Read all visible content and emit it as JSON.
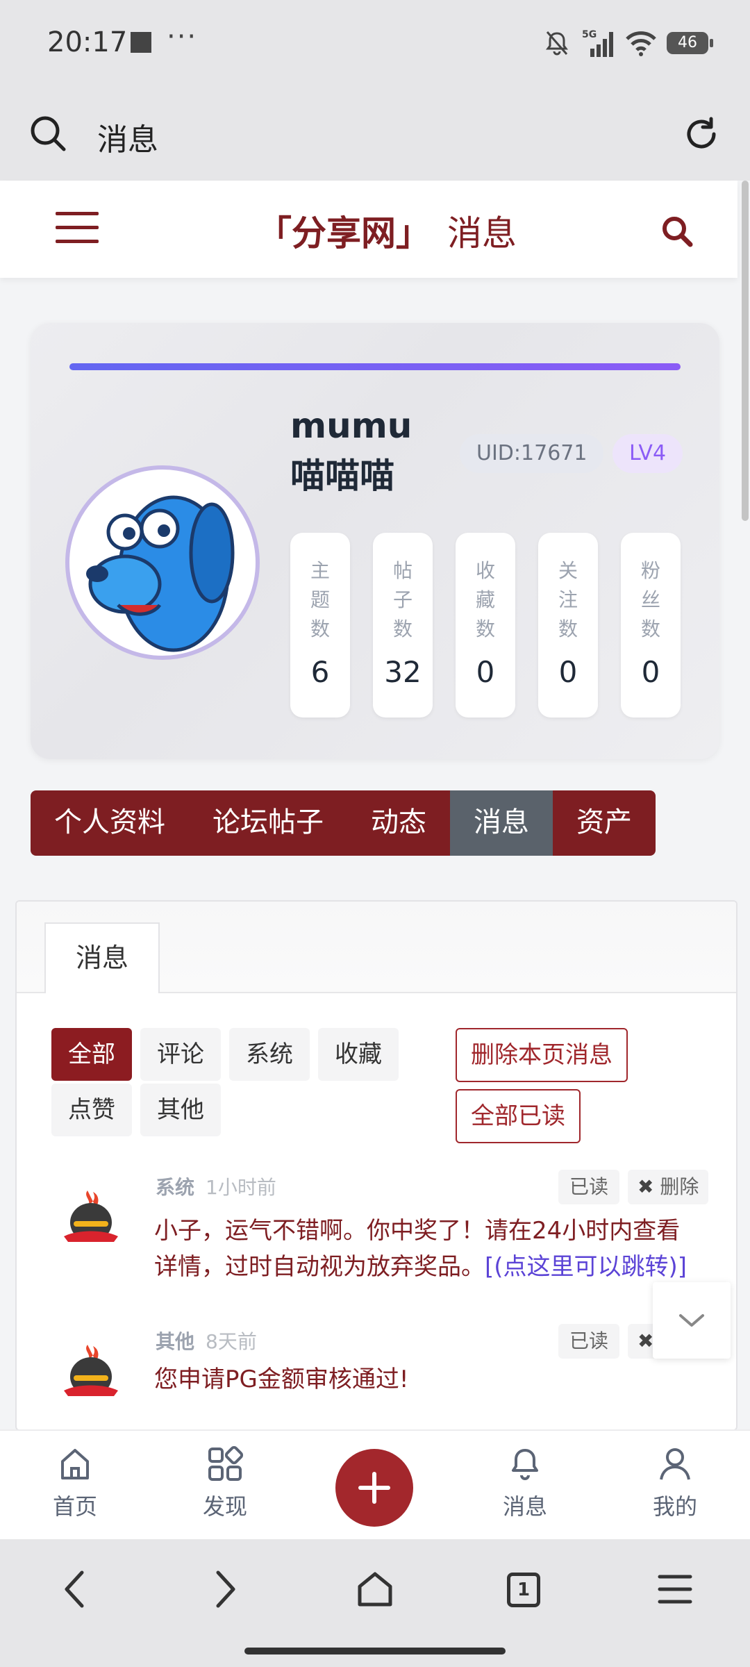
{
  "status_bar": {
    "time": "20:17",
    "more": "···",
    "battery": "46",
    "network": "5G"
  },
  "address_bar": {
    "title": "消息"
  },
  "site_header": {
    "brand": "「分享网」",
    "page": "消息"
  },
  "profile": {
    "username": "mumu喵喵喵",
    "uid": "UID:17671",
    "level": "LV4",
    "stats": [
      {
        "label": "主题数",
        "value": "6"
      },
      {
        "label": "帖子数",
        "value": "32"
      },
      {
        "label": "收藏数",
        "value": "0"
      },
      {
        "label": "关注数",
        "value": "0"
      },
      {
        "label": "粉丝数",
        "value": "0"
      }
    ]
  },
  "nav_tabs": [
    "个人资料",
    "论坛帖子",
    "动态",
    "消息",
    "资产"
  ],
  "nav_tabs_active": "消息",
  "panel": {
    "tab": "消息",
    "filters": [
      "全部",
      "评论",
      "系统",
      "收藏",
      "点赞",
      "其他"
    ],
    "active_filter": "全部",
    "delete_page_label": "删除本页消息",
    "mark_all_read_label": "全部已读"
  },
  "messages": [
    {
      "type": "系统",
      "time": "1小时前",
      "read_label": "已读",
      "delete_label": "删除",
      "text": "小子，运气不错啊。你中奖了！请在24小时内查看详情，过时自动视为放弃奖品。",
      "link": "[(点这里可以跳转)]"
    },
    {
      "type": "其他",
      "time": "8天前",
      "read_label": "已读",
      "text": "您申请PG金额审核通过!"
    }
  ],
  "bottom_nav": [
    {
      "label": "首页",
      "icon": "home-icon"
    },
    {
      "label": "发现",
      "icon": "discover-icon"
    },
    {
      "label": "",
      "icon": "plus-icon"
    },
    {
      "label": "消息",
      "icon": "bell-icon"
    },
    {
      "label": "我的",
      "icon": "user-icon"
    }
  ],
  "system_nav": {
    "tab_count": "1"
  },
  "colors": {
    "brand": "#7e1e22",
    "accent": "#a3272c",
    "link": "#5b43d6",
    "level": "#8b5cf6"
  }
}
